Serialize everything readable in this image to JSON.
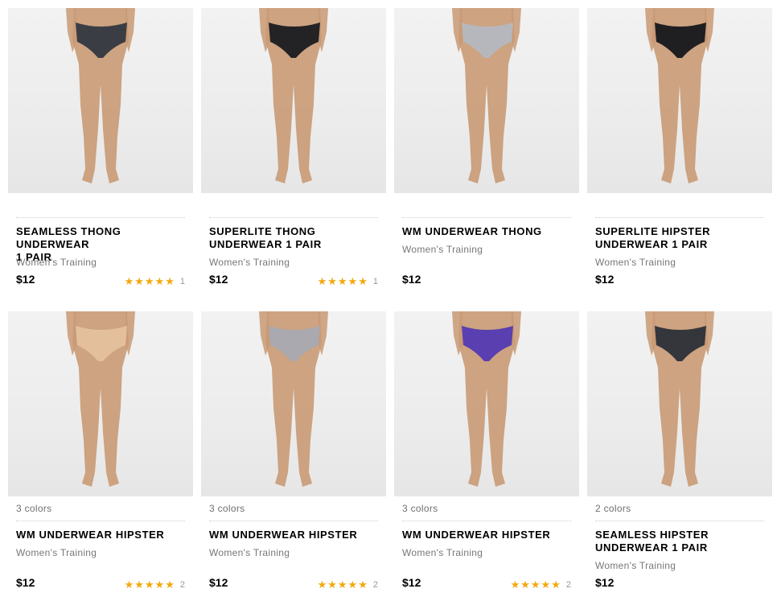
{
  "products": [
    {
      "colors": "",
      "title_lines": [
        "SEAMLESS THONG UNDERWEAR",
        "1 PAIR"
      ],
      "category": "Women's Training",
      "price": "$12",
      "stars": "★★★★★",
      "review_count": "1",
      "garment_color": "#3a3d44"
    },
    {
      "colors": "",
      "title_lines": [
        "SUPERLITE THONG",
        "UNDERWEAR 1 PAIR"
      ],
      "category": "Women's Training",
      "price": "$12",
      "stars": "★★★★★",
      "review_count": "1",
      "garment_color": "#232325"
    },
    {
      "colors": "",
      "title_lines": [
        "WM UNDERWEAR THONG",
        ""
      ],
      "category": "Women's Training",
      "price": "$12",
      "stars": "",
      "review_count": "",
      "garment_color": "#b6b7bc"
    },
    {
      "colors": "",
      "title_lines": [
        "SUPERLITE HIPSTER",
        "UNDERWEAR 1 PAIR"
      ],
      "category": "Women's Training",
      "price": "$12",
      "stars": "",
      "review_count": "",
      "garment_color": "#1f1f22"
    },
    {
      "colors": "3 colors",
      "title_lines": [
        "WM UNDERWEAR HIPSTER",
        ""
      ],
      "category": "Women's Training",
      "price": "$12",
      "stars": "★★★★★",
      "review_count": "2",
      "garment_color": "#e3c09b"
    },
    {
      "colors": "3 colors",
      "title_lines": [
        "WM UNDERWEAR HIPSTER",
        ""
      ],
      "category": "Women's Training",
      "price": "$12",
      "stars": "★★★★★",
      "review_count": "2",
      "garment_color": "#a9a9af"
    },
    {
      "colors": "3 colors",
      "title_lines": [
        "WM UNDERWEAR HIPSTER",
        ""
      ],
      "category": "Women's Training",
      "price": "$12",
      "stars": "★★★★★",
      "review_count": "2",
      "garment_color": "#5a3fb0"
    },
    {
      "colors": "2 colors",
      "title_lines": [
        "SEAMLESS HIPSTER",
        "UNDERWEAR 1 PAIR"
      ],
      "category": "Women's Training",
      "price": "$12",
      "stars": "",
      "review_count": "",
      "garment_color": "#34363c"
    }
  ],
  "theme": {
    "star_color": "#f2a90d",
    "image_bg": "#efefef",
    "skin": "#c99a74"
  }
}
